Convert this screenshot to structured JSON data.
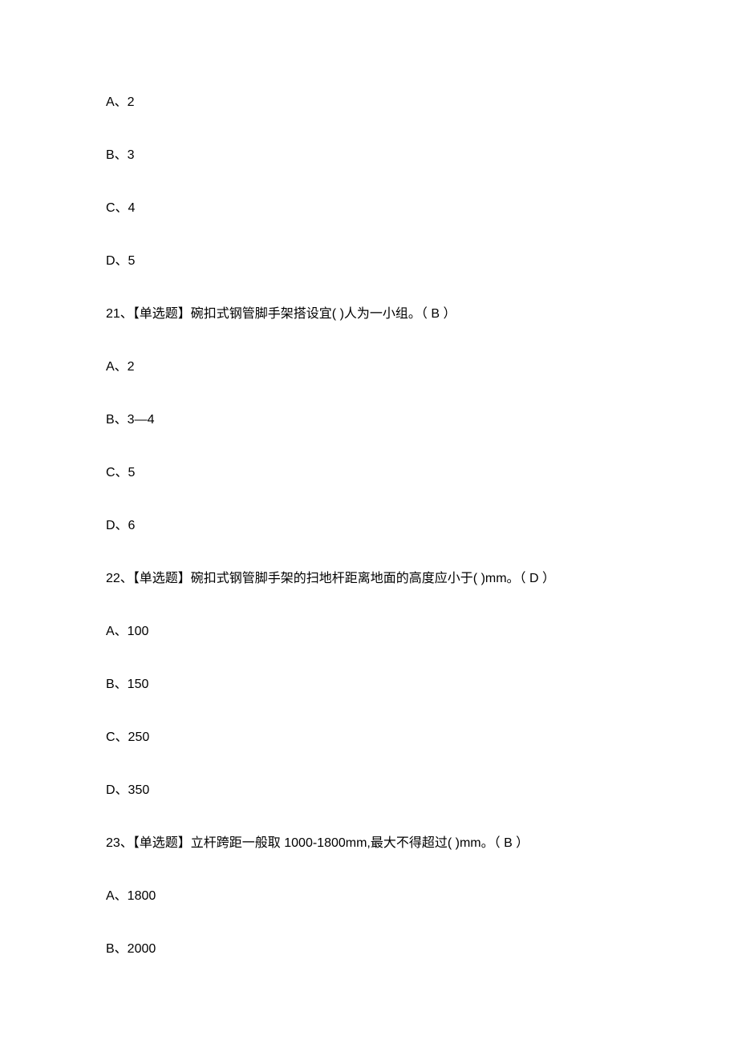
{
  "q20": {
    "opt_a": "A、2",
    "opt_b": "B、3",
    "opt_c": "C、4",
    "opt_d": "D、5"
  },
  "q21": {
    "text": "21、【单选题】碗扣式钢管脚手架搭设宜( )人为一小组。（  B  ）",
    "opt_a": "A、2",
    "opt_b": "B、3—4",
    "opt_c": "C、5",
    "opt_d": "D、6"
  },
  "q22": {
    "text": "22、【单选题】碗扣式钢管脚手架的扫地杆距离地面的高度应小于( )mm。（  D  ）",
    "opt_a": "A、100",
    "opt_b": "B、150",
    "opt_c": "C、250",
    "opt_d": "D、350"
  },
  "q23": {
    "text": "23、【单选题】立杆跨距一般取 1000-1800mm,最大不得超过( )mm。（  B  ）",
    "opt_a": "A、1800",
    "opt_b": "B、2000"
  }
}
